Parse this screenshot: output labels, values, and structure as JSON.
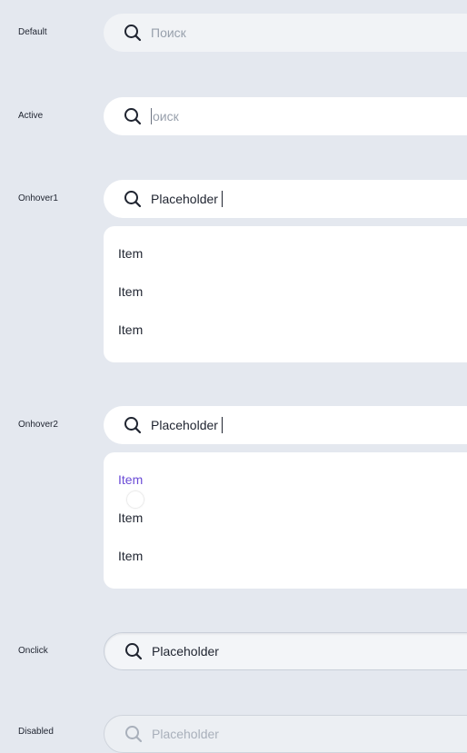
{
  "states": {
    "default": {
      "label": "Default",
      "text": "Поиск"
    },
    "active": {
      "label": "Active",
      "text": "оиск"
    },
    "hover1": {
      "label": "Onhover1",
      "text": "Placeholder"
    },
    "hover2": {
      "label": "Onhover2",
      "text": "Placeholder"
    },
    "click": {
      "label": "Onclick",
      "text": "Placeholder"
    },
    "disabled": {
      "label": "Disabled",
      "text": "Placeholder"
    }
  },
  "dropdown1": {
    "items": [
      "Item",
      "Item",
      "Item"
    ]
  },
  "dropdown2": {
    "items": [
      "Item",
      "Item",
      "Item"
    ],
    "highlighted_index": 0
  },
  "icon": "search-icon",
  "colors": {
    "background": "#e4e8ef",
    "highlight": "#6a4bd6",
    "text": "#1f2430",
    "placeholder": "#98a0ac"
  }
}
